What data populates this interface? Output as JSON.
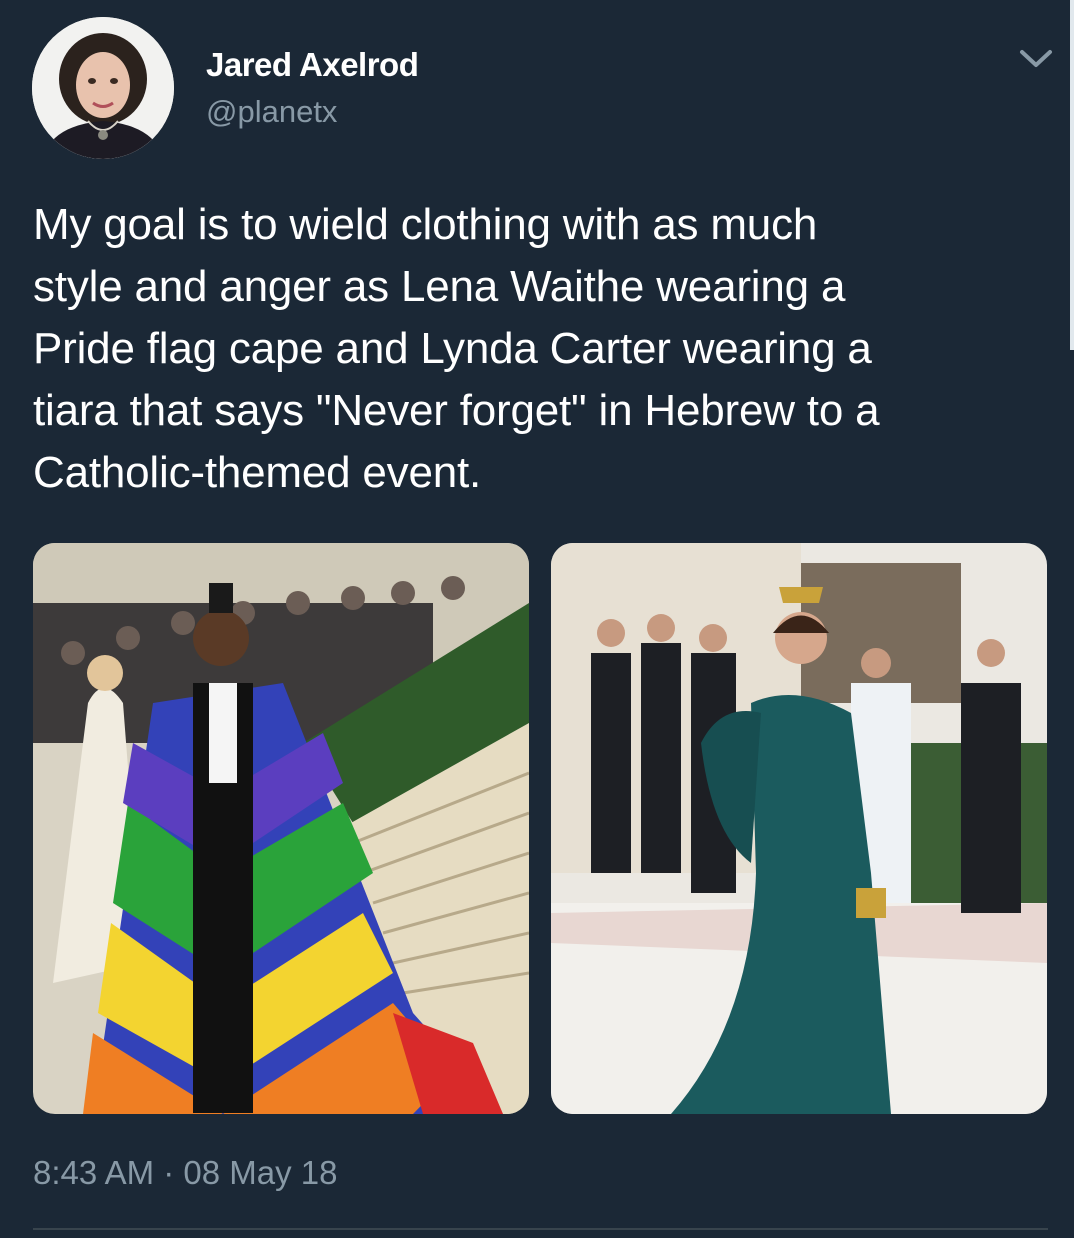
{
  "user": {
    "display_name": "Jared Axelrod",
    "handle": "@planetx",
    "avatar_icon": "profile-photo"
  },
  "tweet": {
    "text": "My goal is to wield clothing with as much\nstyle and anger as Lena Waithe wearing a\nPride flag cape and Lynda Carter wearing a\ntiara that says \"Never forget\" in Hebrew to a\nCatholic-themed event.",
    "timestamp": "8:43 AM · 08 May 18"
  },
  "media": [
    {
      "name": "photo-rainbow-cape"
    },
    {
      "name": "photo-teal-gown-tiara"
    }
  ],
  "colors": {
    "background": "#1b2836",
    "secondary_text": "#8899a6",
    "divider": "#38444d"
  },
  "icons": {
    "menu": "chevron-down-icon"
  }
}
